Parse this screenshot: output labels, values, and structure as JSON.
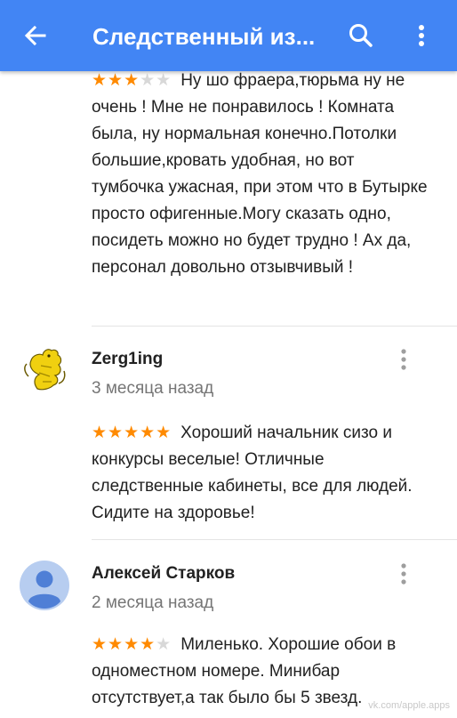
{
  "appbar": {
    "title": "Следственный из...",
    "back_icon": "arrow-back-icon",
    "search_icon": "search-icon",
    "more_icon": "more-vert-icon",
    "color": "#4285f4"
  },
  "reviews": [
    {
      "rating": 3,
      "stars_on": "★★★",
      "stars_off": "★★",
      "text": "Ну шо фраера,тюрьма ну не очень ! Мне не понравилось ! Комната была, ну нормальная конечно.Потолки большие,кровать удобная, но вот тумбочка ужасная, при этом что в Бутырке просто офигенные.Могу сказать одно, посидеть можно но будет трудно ! Ах да, персонал довольно отзывчивый !"
    },
    {
      "author": "Zerg1ing",
      "date": "3 месяца назад",
      "avatar_icon": "heraldic-lion-avatar-icon",
      "rating": 5,
      "stars_on": "★★★★★",
      "stars_off": "",
      "text": "Хороший начальник сизо и конкурсы веселые! Отличные следственные кабинеты, все для людей. Сидите на здоровье!"
    },
    {
      "author": "Алексей Старков",
      "date": "2 месяца назад",
      "avatar_icon": "default-person-avatar-icon",
      "rating": 4,
      "stars_on": "★★★★",
      "stars_off": "★",
      "text": "Миленько. Хорошие обои в одноместном номере. Минибар отсутствует,а так было бы 5 звезд."
    }
  ],
  "watermark": "vk.com/apple.apps",
  "colors": {
    "star_on": "#ff8a00",
    "star_off": "#d8d8d8",
    "text": "#212121",
    "secondary_text": "#757575"
  }
}
